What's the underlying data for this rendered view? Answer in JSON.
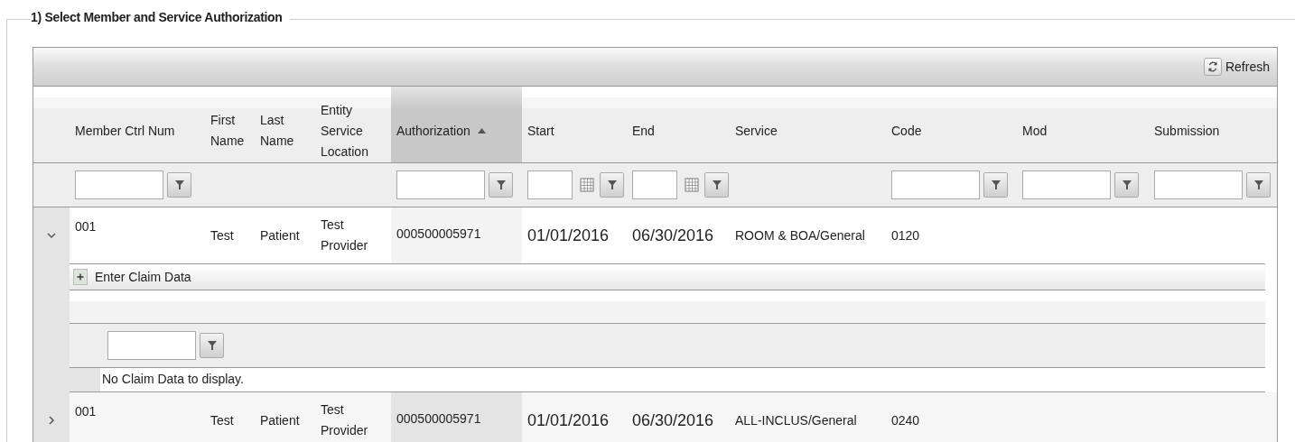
{
  "section": {
    "title": "1) Select Member and Service Authorization"
  },
  "toolbar": {
    "refresh_label": "Refresh"
  },
  "table": {
    "columns": [
      {
        "label": "Member Ctrl Num",
        "filter": true,
        "kind": "text",
        "sorted": false
      },
      {
        "label": "First Name",
        "filter": false,
        "kind": "text",
        "sorted": false
      },
      {
        "label": "Last Name",
        "filter": false,
        "kind": "text",
        "sorted": false
      },
      {
        "label": "Entity Service Location",
        "filter": false,
        "kind": "text",
        "sorted": false
      },
      {
        "label": "Authorization",
        "filter": true,
        "kind": "text",
        "sorted": true
      },
      {
        "label": "Start",
        "filter": true,
        "kind": "date",
        "sorted": false
      },
      {
        "label": "End",
        "filter": true,
        "kind": "date",
        "sorted": false
      },
      {
        "label": "Service",
        "filter": false,
        "kind": "text",
        "sorted": false
      },
      {
        "label": "Code",
        "filter": true,
        "kind": "text",
        "sorted": false
      },
      {
        "label": "Mod",
        "filter": true,
        "kind": "text",
        "sorted": false
      },
      {
        "label": "Submission",
        "filter": true,
        "kind": "text",
        "sorted": false
      }
    ],
    "rows": [
      {
        "expanded": true,
        "cells": [
          "001",
          "Test",
          "Patient",
          "Test Provider",
          "000500005971",
          "01/01/2016",
          "06/30/2016",
          "ROOM & BOA/General",
          "0120",
          "",
          ""
        ],
        "detail": {
          "add_label": "Enter Claim Data",
          "empty_message": "No Claim Data to display."
        }
      },
      {
        "expanded": false,
        "cells": [
          "001",
          "Test",
          "Patient",
          "Test Provider",
          "000500005971",
          "01/01/2016",
          "06/30/2016",
          "ALL-INCLUS/General",
          "0240",
          "",
          ""
        ]
      }
    ]
  }
}
